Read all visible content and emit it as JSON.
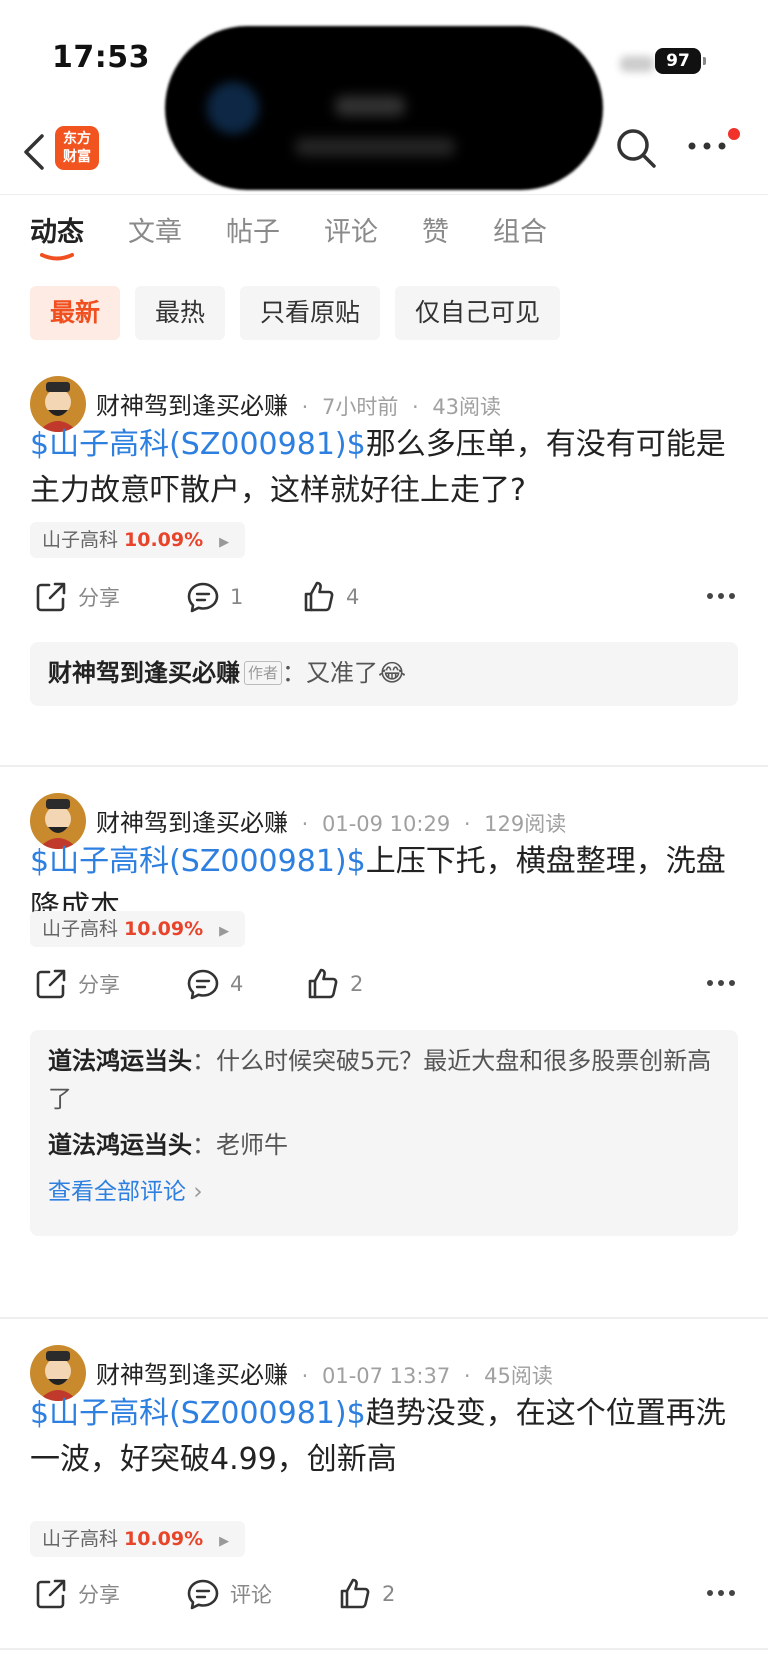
{
  "status_bar": {
    "time": "17:53",
    "battery": "97"
  },
  "nav": {
    "logo_text": "东方财富"
  },
  "tabs": [
    {
      "label": "动态",
      "active": true
    },
    {
      "label": "文章",
      "active": false
    },
    {
      "label": "帖子",
      "active": false
    },
    {
      "label": "评论",
      "active": false
    },
    {
      "label": "赞",
      "active": false
    },
    {
      "label": "组合",
      "active": false
    }
  ],
  "filters": [
    {
      "label": "最新",
      "active": true
    },
    {
      "label": "最热",
      "active": false
    },
    {
      "label": "只看原贴",
      "active": false
    },
    {
      "label": "仅自己可见",
      "active": false
    }
  ],
  "posts": [
    {
      "author": "财神驾到逢买必赚",
      "time": "7小时前",
      "reads": "43阅读",
      "stock_tag": "$山子高科(SZ000981)$",
      "text": "那么多压单，有没有可能是主力故意吓散户，这样就好往上走了?",
      "stock_name": "山子高科",
      "stock_change": "10.09%",
      "share_label": "分享",
      "comment_count": "1",
      "like_count": "4",
      "comments": [
        {
          "author": "财神驾到逢买必赚",
          "tag": "作者",
          "separator": "：",
          "text": "又准了😂"
        }
      ]
    },
    {
      "author": "财神驾到逢买必赚",
      "time": "01-09 10:29",
      "reads": "129阅读",
      "stock_tag": "$山子高科(SZ000981)$",
      "text": "上压下托，横盘整理，洗盘降成本",
      "stock_name": "山子高科",
      "stock_change": "10.09%",
      "share_label": "分享",
      "comment_count": "4",
      "like_count": "2",
      "comments": [
        {
          "author": "道法鸿运当头",
          "separator": "：",
          "text": "什么时候突破5元？最近大盘和很多股票创新高了"
        },
        {
          "author": "道法鸿运当头",
          "separator": "：",
          "text": "老师牛"
        }
      ],
      "view_all": "查看全部评论"
    },
    {
      "author": "财神驾到逢买必赚",
      "time": "01-07 13:37",
      "reads": "45阅读",
      "stock_tag": "$山子高科(SZ000981)$",
      "text": "趋势没变，在这个位置再洗一波，好突破4.99，创新高",
      "stock_name": "山子高科",
      "stock_change": "10.09%",
      "share_label": "分享",
      "comment_label": "评论",
      "like_count": "2"
    }
  ],
  "colors": {
    "accent": "#f0501f",
    "link": "#2d7fe0",
    "rise": "#e8442a"
  }
}
